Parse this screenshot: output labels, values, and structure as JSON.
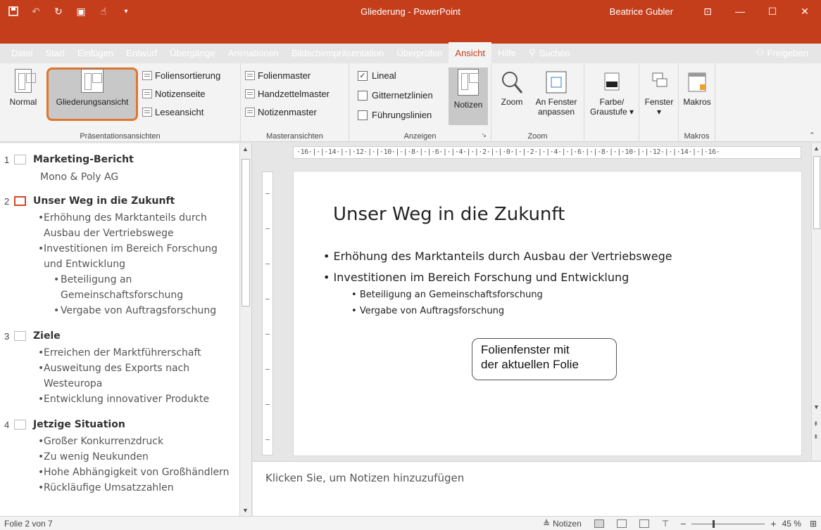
{
  "window": {
    "title": "Gliederung - PowerPoint",
    "user": "Beatrice Gubler",
    "accent": "#c43e1c"
  },
  "qat": {
    "save": "save-icon",
    "undo": "undo-icon",
    "redo": "redo-icon"
  },
  "tabs": [
    "Datei",
    "Start",
    "Einfügen",
    "Entwurf",
    "Übergänge",
    "Animationen",
    "Bildschirmpräsentation",
    "Überprüfen",
    "Ansicht",
    "Hilfe"
  ],
  "active_tab": "Ansicht",
  "search_label": "Suchen",
  "share_label": "Freigeben",
  "ribbon": {
    "presentation_views": {
      "label": "Präsentationsansichten",
      "normal": "Normal",
      "outline": "Gliederungsansicht",
      "slide_sorter": "Foliensortierung",
      "notes_page": "Notizenseite",
      "reading": "Leseansicht"
    },
    "master_views": {
      "label": "Masteransichten",
      "slide_master": "Folienmaster",
      "handout_master": "Handzettelmaster",
      "notes_master": "Notizenmaster"
    },
    "show": {
      "label": "Anzeigen",
      "ruler": "Lineal",
      "ruler_checked": true,
      "gridlines": "Gitternetzlinien",
      "guides": "Führungslinien",
      "notes": "Notizen"
    },
    "zoom": {
      "label": "Zoom",
      "zoom": "Zoom",
      "fit_line1": "An Fenster",
      "fit_line2": "anpassen"
    },
    "color": {
      "line1": "Farbe/",
      "line2": "Graustufe"
    },
    "window": "Fenster",
    "macros": {
      "label": "Makros",
      "button": "Makros"
    }
  },
  "outline": [
    {
      "num": "1",
      "title": "Marketing-Bericht",
      "sub": "Mono & Poly AG",
      "bullets": []
    },
    {
      "num": "2",
      "title": "Unser Weg in die Zukunft",
      "current": true,
      "bullets": [
        {
          "level": 1,
          "text": "Erhöhung des Marktanteils durch Ausbau der Vertriebswege"
        },
        {
          "level": 1,
          "text": "Investitionen im Bereich Forschung und Entwicklung"
        },
        {
          "level": 2,
          "text": "Beteiligung an Gemeinschaftsforschung"
        },
        {
          "level": 2,
          "text": "Vergabe von Auftragsforschung"
        }
      ]
    },
    {
      "num": "3",
      "title": "Ziele",
      "bullets": [
        {
          "level": 1,
          "text": "Erreichen der Marktführerschaft"
        },
        {
          "level": 1,
          "text": "Ausweitung des Exports nach Westeuropa"
        },
        {
          "level": 1,
          "text": "Entwicklung innovativer Produkte"
        }
      ]
    },
    {
      "num": "4",
      "title": "Jetzige Situation",
      "bullets": [
        {
          "level": 1,
          "text": "Großer Konkurrenzdruck"
        },
        {
          "level": 1,
          "text": "Zu wenig Neukunden"
        },
        {
          "level": 1,
          "text": "Hohe Abhängigkeit von Großhändlern"
        },
        {
          "level": 1,
          "text": "Rückläufige Umsatzzahlen"
        }
      ]
    }
  ],
  "ruler_text": "·16·|·|·14·|·|·12·|·|·10·|·|·8·|·|·6·|·|·4·|·|·2·|·|·0·|·|·2·|·|·4·|·|·6·|·|·8·|·|·10·|·|·12·|·|·14·|·|·16·",
  "slide": {
    "title": "Unser Weg in die Zukunft",
    "b1": "Erhöhung des Marktanteils durch Ausbau der Vertriebswege",
    "b2": "Investitionen im Bereich Forschung und Entwicklung",
    "b3": "Beteiligung an Gemeinschaftsforschung",
    "b4": "Vergabe von Auftragsforschung",
    "callout_line1": "Folienfenster mit",
    "callout_line2": "der aktuellen Folie"
  },
  "notes_placeholder": "Klicken Sie, um Notizen hinzuzufügen",
  "status": {
    "slide_info": "Folie 2 von 7",
    "notes": "Notizen",
    "zoom": "45 %"
  }
}
